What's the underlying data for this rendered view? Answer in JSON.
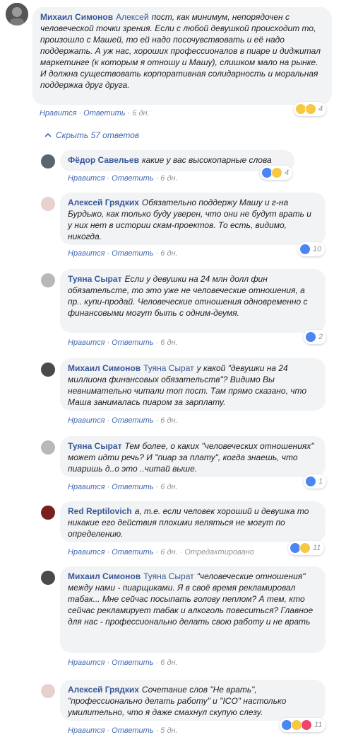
{
  "top": {
    "author": "Михаил Симонов",
    "mention": "Алексей",
    "text": "пост, как минимум, непорядочен с человеческой точки зрения. Если с любой девушкой происходит то, произошло с Машей, то ей надо посочувствовать и её надо поддержать. А уж нас, хороших профессионалов в пиаре и диджитал маркетинге (к которым я отношу и Машу), слишком мало на рынке. И должна существовать корпоративная солидарность и моральная поддержка друг друга.",
    "like": "Нравится",
    "reply": "Ответить",
    "time": "6 дн.",
    "reactions": "4"
  },
  "toggle": {
    "label": "Скрыть 57 ответов"
  },
  "replies": [
    {
      "author": "Фёдор Савельев",
      "mention": "",
      "text": "какие у вас высокопарные слова",
      "like": "Нравится",
      "reply": "Ответить",
      "time": "6 дн.",
      "edited": "",
      "reactions": "4"
    },
    {
      "author": "Алексей Грядких",
      "mention": "",
      "text": "Обязательно поддержу Машу и г-на Бурдыко, как только буду уверен, что они не будут врать и у них нет в истории скам-проектов. То есть, видимо, никогда.",
      "like": "Нравится",
      "reply": "Ответить",
      "time": "6 дн.",
      "edited": "",
      "reactions": "10"
    },
    {
      "author": "Туяна Сырат",
      "mention": "",
      "text": "Если у девушки на 24 млн долл фин обязательсте, то это уже не человеческие отношения, а пр.. купи-продай. Человеческие отношения одновременно с финансовыми могут быть с одним-деумя.",
      "like": "Нравится",
      "reply": "Ответить",
      "time": "6 дн.",
      "edited": "",
      "reactions": "2"
    },
    {
      "author": "Михаил Симонов",
      "mention": "Туяна Сырат",
      "text": "у какой \"девушки на 24 миллиона финансовых обязательств\"? Видимо Вы невнимательно читали топ пост. Там прямо сказано, что Маша занималась пиаром за зарплату.",
      "like": "Нравится",
      "reply": "Ответить",
      "time": "6 дн.",
      "edited": "",
      "reactions": ""
    },
    {
      "author": "Туяна Сырат",
      "mention": "",
      "text": "Тем более, о каких \"человеческих отношениях\" может идти речь? И \"пиар за плату\", когда знаешь, что пиаришь д..о это ..читай выше.",
      "like": "Нравится",
      "reply": "Ответить",
      "time": "6 дн.",
      "edited": "",
      "reactions": "1"
    },
    {
      "author": "Red Reptilovich",
      "mention": "",
      "text": "а, т.е. если человек хороший и девушка то никакие его действия плохими яеляться не могут по определению.",
      "like": "Нравится",
      "reply": "Ответить",
      "time": "6 дн.",
      "edited": "Отредактировано",
      "reactions": "11"
    },
    {
      "author": "Михаил Симонов",
      "mention": "Туяна Сырат",
      "text": "\"человеческие отношения\" между нами - пиарщиками. Я в своё время рекламировал табак... Мне сейчас посыпать голову пеплом? А тем, кто сейчас рекламирует табак и алкоголь повеситься? Главное для нас - профессионально делать свою работу и не врать",
      "like": "Нравится",
      "reply": "Ответить",
      "time": "6 дн.",
      "edited": "",
      "reactions": ""
    },
    {
      "author": "Алексей Грядких",
      "mention": "",
      "text": "Сочетание слов \"Не врать\", \"профессионально делать работу\" и \"ICO\" настолько умилительно, что я даже смахнул скупую слезу.",
      "like": "Нравится",
      "reply": "Ответить",
      "time": "5 дн.",
      "edited": "",
      "reactions": "11"
    }
  ],
  "colors": {
    "link": "#385898",
    "bubble": "#f2f3f5",
    "meta": "#90949c"
  }
}
